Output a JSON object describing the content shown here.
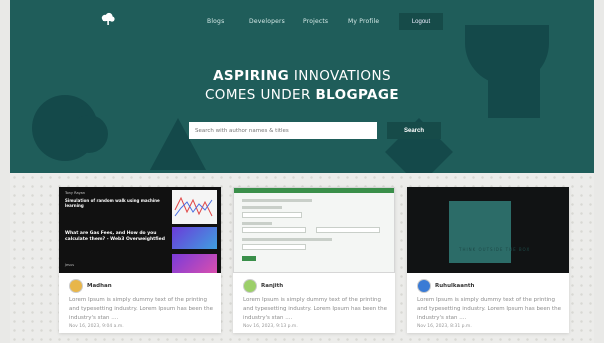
{
  "nav": {
    "links": [
      "Blogs",
      "Developers",
      "Projects",
      "My Profile"
    ],
    "logout": "Logout"
  },
  "hero": {
    "line1_bold": "ASPIRING",
    "line1_rest": " INNOVATIONS",
    "line2_rest": "COMES UNDER ",
    "line2_bold": "BLOGPAGE"
  },
  "search": {
    "placeholder": "Search with author names & titles",
    "button": "Search"
  },
  "cards": [
    {
      "author": "Madhan",
      "excerpt": "Lorem Ipsum is simply dummy text of the printing and typesetting industry. Lorem Ipsum has been the industry's stan ....",
      "date": "Nov 16, 2023, 9:04 a.m.",
      "thumb": {
        "header": "Tony Rayan",
        "title": "Simulation of random walk using machine learning",
        "question": "What are Gas Fees, and How do you calculate them? - Web3 Overweightfied",
        "meta": "Jesus"
      }
    },
    {
      "author": "Ranjith",
      "excerpt": "Lorem Ipsum is simply dummy text of the printing and typesetting industry. Lorem Ipsum has been the industry's stan ....",
      "date": "Nov 16, 2023, 9:13 p.m."
    },
    {
      "author": "Ruhulkaanth",
      "excerpt": "Lorem Ipsum is simply dummy text of the printing and typesetting industry. Lorem Ipsum has been the industry's stan ....",
      "date": "Nov 16, 2023, 8:31 p.m.",
      "thumb": {
        "text": "THINK OUTSIDE THE BOX"
      }
    }
  ],
  "colors": {
    "hero_bg": "#1f5d5a",
    "accent_dark": "#164b49",
    "card_bg": "#ffffff"
  }
}
